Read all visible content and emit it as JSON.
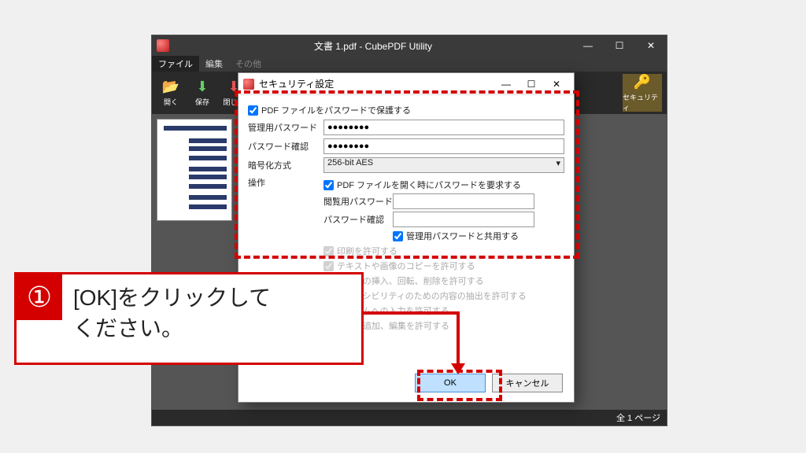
{
  "outer": {
    "title": "文書 1.pdf - CubePDF Utility",
    "menu": {
      "file": "ファイル",
      "edit": "編集",
      "other": "その他"
    },
    "tools": {
      "open": "開く",
      "save": "保存",
      "close": "閉じる",
      "security": "セキュリティ"
    },
    "status": "全 1 ページ"
  },
  "dialog": {
    "title": "セキュリティ設定",
    "protect": "PDF ファイルをパスワードで保護する",
    "admin_pw_label": "管理用パスワード",
    "admin_pw_value": "●●●●●●●●",
    "confirm_label": "パスワード確認",
    "confirm_value": "●●●●●●●●",
    "enc_label": "暗号化方式",
    "enc_value": "256-bit AES",
    "ops_label": "操作",
    "require_pw": "PDF ファイルを開く時にパスワードを要求する",
    "view_pw_label": "閲覧用パスワード",
    "view_confirm_label": "パスワード確認",
    "share_admin": "管理用パスワードと共用する",
    "allow_print": "印刷を許可する",
    "allow_copy": "テキストや画像のコピーを許可する",
    "allow_modify": "ページの挿入、回転、削除を許可する",
    "allow_access": "アクセシビリティのための内容の抽出を許可する",
    "allow_form": "フォームへの入力を許可する",
    "allow_annot": "注釈の追加、編集を許可する",
    "ok": "OK",
    "cancel": "キャンセル"
  },
  "callout": {
    "num": "①",
    "text_l1": "[OK]をクリックして",
    "text_l2": "ください。"
  }
}
